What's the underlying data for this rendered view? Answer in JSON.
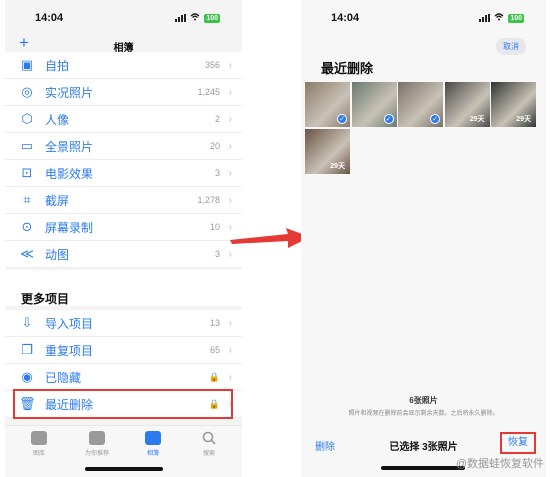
{
  "left": {
    "status_time": "14:04",
    "battery": "100",
    "nav_title": "相簿",
    "add_icon": "plus-icon",
    "media_items": [
      {
        "label": "自拍",
        "count": "356",
        "icon": "person-square-icon"
      },
      {
        "label": "实况照片",
        "count": "1,245",
        "icon": "live-photo-icon"
      },
      {
        "label": "人像",
        "count": "2",
        "icon": "cube-icon"
      },
      {
        "label": "全景照片",
        "count": "20",
        "icon": "panorama-icon"
      },
      {
        "label": "电影效果",
        "count": "3",
        "icon": "cinematic-icon"
      },
      {
        "label": "截屏",
        "count": "1,278",
        "icon": "screenshot-icon"
      },
      {
        "label": "屏幕录制",
        "count": "10",
        "icon": "record-icon"
      },
      {
        "label": "动图",
        "count": "3",
        "icon": "animated-icon"
      }
    ],
    "more_section": "更多项目",
    "more_items": [
      {
        "label": "导入项目",
        "count": "13",
        "icon": "import-icon"
      },
      {
        "label": "重复项目",
        "count": "65",
        "icon": "duplicate-icon"
      },
      {
        "label": "已隐藏",
        "count": "",
        "icon": "hidden-eye-icon"
      },
      {
        "label": "最近删除",
        "count": "",
        "icon": "trash-icon"
      }
    ],
    "tabs": [
      {
        "label": "图库",
        "icon": "library-icon"
      },
      {
        "label": "为你推荐",
        "icon": "for-you-icon"
      },
      {
        "label": "相簿",
        "icon": "albums-icon",
        "active": true
      },
      {
        "label": "搜索",
        "icon": "search-icon"
      }
    ]
  },
  "right": {
    "status_time": "14:04",
    "battery": "100",
    "cancel_label": "取消",
    "title": "最近删除",
    "photos": [
      {
        "selected": true,
        "days": "",
        "color": "#8a7a6a"
      },
      {
        "selected": true,
        "days": "",
        "color": "#6a7a70"
      },
      {
        "selected": true,
        "days": "",
        "color": "#7a7068"
      },
      {
        "selected": false,
        "days": "29天",
        "color": "#4a4848"
      },
      {
        "selected": false,
        "days": "29天",
        "color": "#2e3432"
      },
      {
        "selected": false,
        "days": "29天",
        "color": "#6a5444"
      }
    ],
    "photo_count": "6张照片",
    "note": "照片和视频在删除前会显示剩余天数。之后将永久删除。",
    "delete_label": "删除",
    "selected_label": "已选择 3张照片",
    "recover_label": "恢复"
  },
  "watermark": "@数据蛙恢复软件",
  "colors": {
    "accent": "#2b7bf0",
    "highlight": "#e53935",
    "arrow": "#e53935"
  }
}
